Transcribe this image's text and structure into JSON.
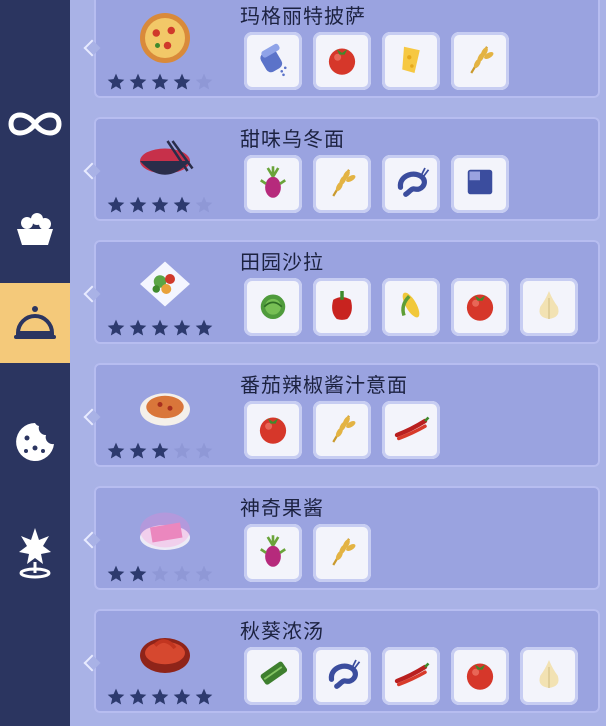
{
  "sidebar": {
    "items": [
      {
        "icon": "infinity-icon"
      },
      {
        "icon": "bowl-icon"
      },
      {
        "icon": "cloche-icon",
        "active": true
      },
      {
        "icon": "cookie-icon"
      },
      {
        "icon": "sparkle-pin-icon"
      }
    ]
  },
  "recipes": [
    {
      "name": "玛格丽特披萨",
      "stars": 4,
      "max_stars": 5,
      "dish_icon": "pizza-icon",
      "ingredients": [
        "salt-shaker-icon",
        "tomato-icon",
        "cheese-icon",
        "wheat-icon"
      ]
    },
    {
      "name": "甜味乌冬面",
      "stars": 4,
      "max_stars": 5,
      "dish_icon": "udon-bowl-icon",
      "ingredients": [
        "dragonfruit-icon",
        "wheat-icon",
        "shrimp-icon",
        "unknown-ingredient-icon"
      ]
    },
    {
      "name": "田园沙拉",
      "stars": 5,
      "max_stars": 5,
      "dish_icon": "salad-icon",
      "ingredients": [
        "lettuce-icon",
        "bell-pepper-icon",
        "corn-icon",
        "tomato-icon",
        "garlic-icon"
      ]
    },
    {
      "name": "番茄辣椒酱汁意面",
      "stars": 3,
      "max_stars": 5,
      "dish_icon": "pasta-icon",
      "ingredients": [
        "tomato-icon",
        "wheat-icon",
        "chili-icon"
      ]
    },
    {
      "name": "神奇果酱",
      "stars": 2,
      "max_stars": 5,
      "dish_icon": "jam-icon",
      "ingredients": [
        "dragonfruit-icon",
        "wheat-icon"
      ]
    },
    {
      "name": "秋葵浓汤",
      "stars": 5,
      "max_stars": 5,
      "dish_icon": "gumbo-icon",
      "ingredients": [
        "okra-icon",
        "shrimp-icon",
        "chili-icon",
        "tomato-icon",
        "garlic-icon"
      ]
    }
  ],
  "colors": {
    "star_filled": "#2d3a6e",
    "star_empty": "#8f98d6",
    "active_tab": "#f4c97a"
  }
}
